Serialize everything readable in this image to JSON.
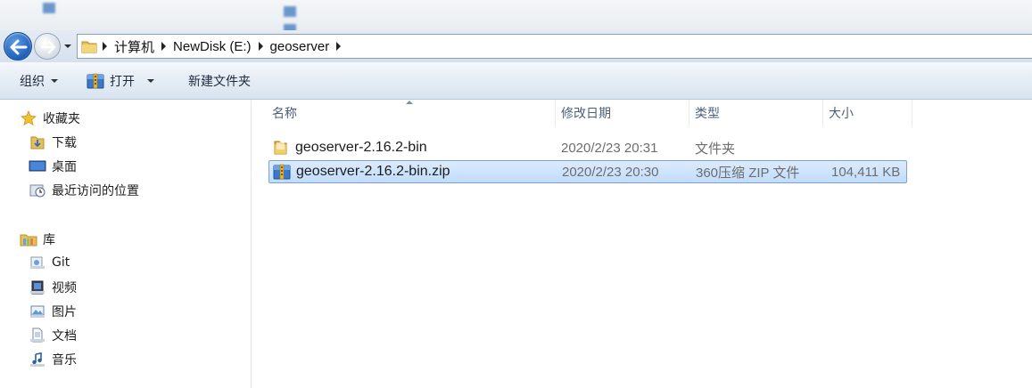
{
  "address_bar": {
    "crumbs": [
      "计算机",
      "NewDisk (E:)",
      "geoserver"
    ]
  },
  "toolbar": {
    "organize_label": "组织",
    "open_label": "打开",
    "new_folder_label": "新建文件夹"
  },
  "nav": {
    "favorites_label": "收藏夹",
    "favorites": [
      "下载",
      "桌面",
      "最近访问的位置"
    ],
    "library_label": "库",
    "libraries": [
      "Git",
      "视频",
      "图片",
      "文档",
      "音乐"
    ]
  },
  "columns": {
    "name": "名称",
    "date": "修改日期",
    "type": "类型",
    "size": "大小"
  },
  "files": [
    {
      "name": "geoserver-2.16.2-bin",
      "date": "2020/2/23 20:31",
      "type": "文件夹",
      "size": "",
      "icon": "folder-icon",
      "selected": false
    },
    {
      "name": "geoserver-2.16.2-bin.zip",
      "date": "2020/2/23 20:30",
      "type": "360压缩 ZIP 文件",
      "size": "104,411 KB",
      "icon": "zip-archive-icon",
      "selected": true
    }
  ],
  "colors": {
    "selection_bg": "#c9e0fb",
    "selection_border": "#7da2ce",
    "toolbar_bg": "#e3ebf5",
    "header_text": "#4c607a"
  }
}
